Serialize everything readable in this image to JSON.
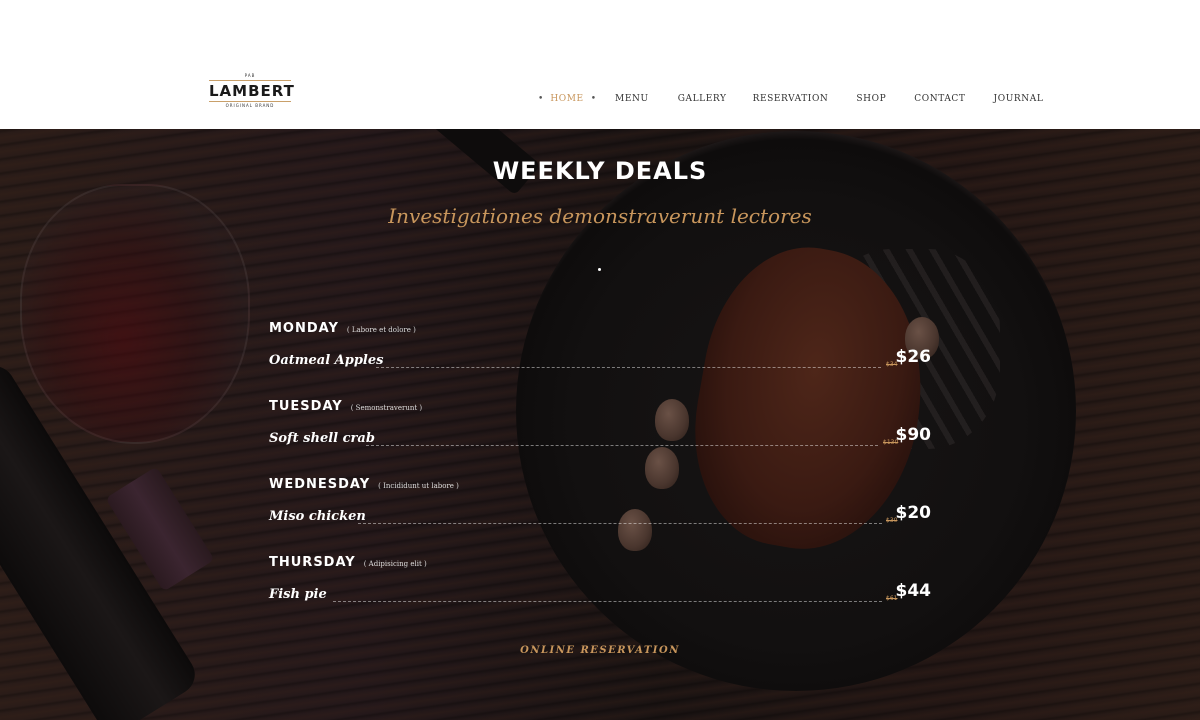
{
  "brand": {
    "top_text": "PAB",
    "name": "LAMBERT",
    "bottom_text": "ORIGINAL BRAND"
  },
  "nav": {
    "items": [
      {
        "label": "HOME",
        "active": true
      },
      {
        "label": "MENU"
      },
      {
        "label": "GALLERY"
      },
      {
        "label": "RESERVATION"
      },
      {
        "label": "SHOP"
      },
      {
        "label": "CONTACT"
      },
      {
        "label": "JOURNAL"
      }
    ]
  },
  "section": {
    "title": "WEEKLY DEALS",
    "subtitle": "Investigationes demonstraverunt lectores"
  },
  "deals": [
    {
      "day": "MONDAY",
      "note": "( Labore et dolore )",
      "dish": "Oatmeal Apples",
      "old_price": "$34",
      "price": "$26"
    },
    {
      "day": "TUESDAY",
      "note": "( Semonstraverunt )",
      "dish": "Soft shell crab",
      "old_price": "$130",
      "price": "$90"
    },
    {
      "day": "WEDNESDAY",
      "note": "( Incididunt ut labore )",
      "dish": "Miso chicken",
      "old_price": "$30",
      "price": "$20"
    },
    {
      "day": "THURSDAY",
      "note": "( Adipisicing elit )",
      "dish": "Fish pie",
      "old_price": "$61",
      "price": "$44"
    }
  ],
  "cta": {
    "label": "ONLINE RESERVATION"
  },
  "colors": {
    "accent": "#c8965c",
    "header_bg": "#ffffff",
    "hero_bg": "#1f1614"
  }
}
